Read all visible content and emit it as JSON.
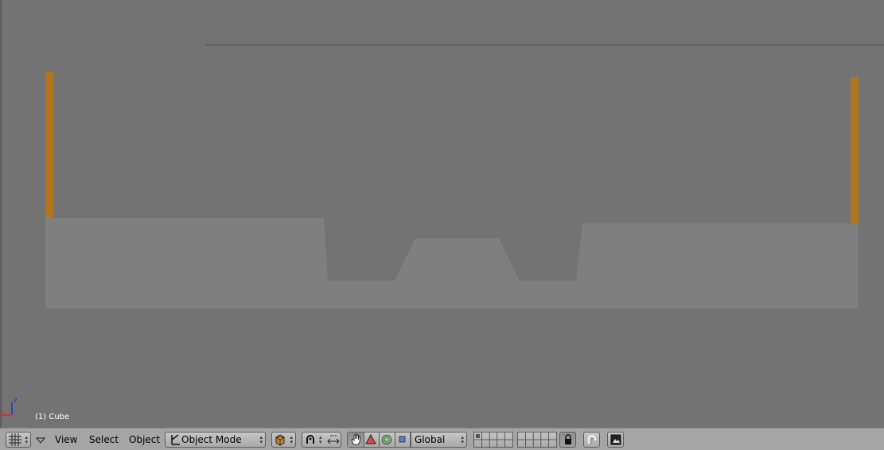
{
  "viewport": {
    "object_label": "(1) Cube",
    "axis_labels": {
      "z": "z",
      "x": "x"
    }
  },
  "header": {
    "editor_type_icon": "grid-icon",
    "menus": {
      "view": "View",
      "select": "Select",
      "object": "Object"
    },
    "mode_dropdown": {
      "value": "Object Mode",
      "icon": "object-mode-icon"
    },
    "orientation_dropdown": {
      "value": "Global"
    },
    "colors": {
      "background": "#737373",
      "mesh": "#7f7f7f",
      "selected_edge": "#b1741f",
      "header": "#a5a5a5"
    }
  }
}
